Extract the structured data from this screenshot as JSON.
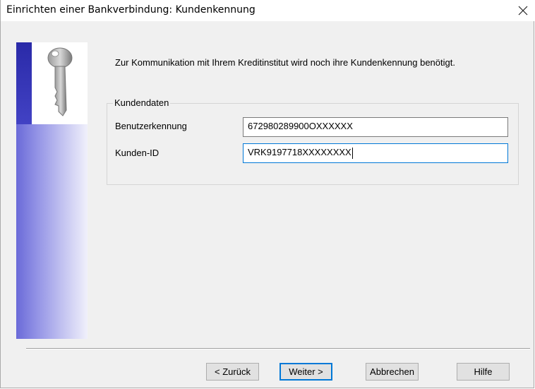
{
  "window": {
    "title": "Einrichten einer Bankverbindung: Kundenkennung"
  },
  "icons": {
    "close": "close-icon",
    "side_image": "key-icon"
  },
  "intro_text": "Zur Kommunikation mit Ihrem Kreditinstitut wird noch ihre Kundenkennung benötigt.",
  "group": {
    "title": "Kundendaten",
    "fields": [
      {
        "label": "Benutzerkennung",
        "value": "672980289900OXXXXXX"
      },
      {
        "label": "Kunden-ID",
        "value": "VRK9197718XXXXXXXX"
      }
    ]
  },
  "buttons": {
    "back": "< Zurück",
    "next": "Weiter >",
    "cancel": "Abbrechen",
    "help": "Hilfe"
  },
  "colors": {
    "accent": "#0078d7",
    "sidebar_dark": "#2a2aa8",
    "sidebar_light": "#c9c9f2"
  }
}
